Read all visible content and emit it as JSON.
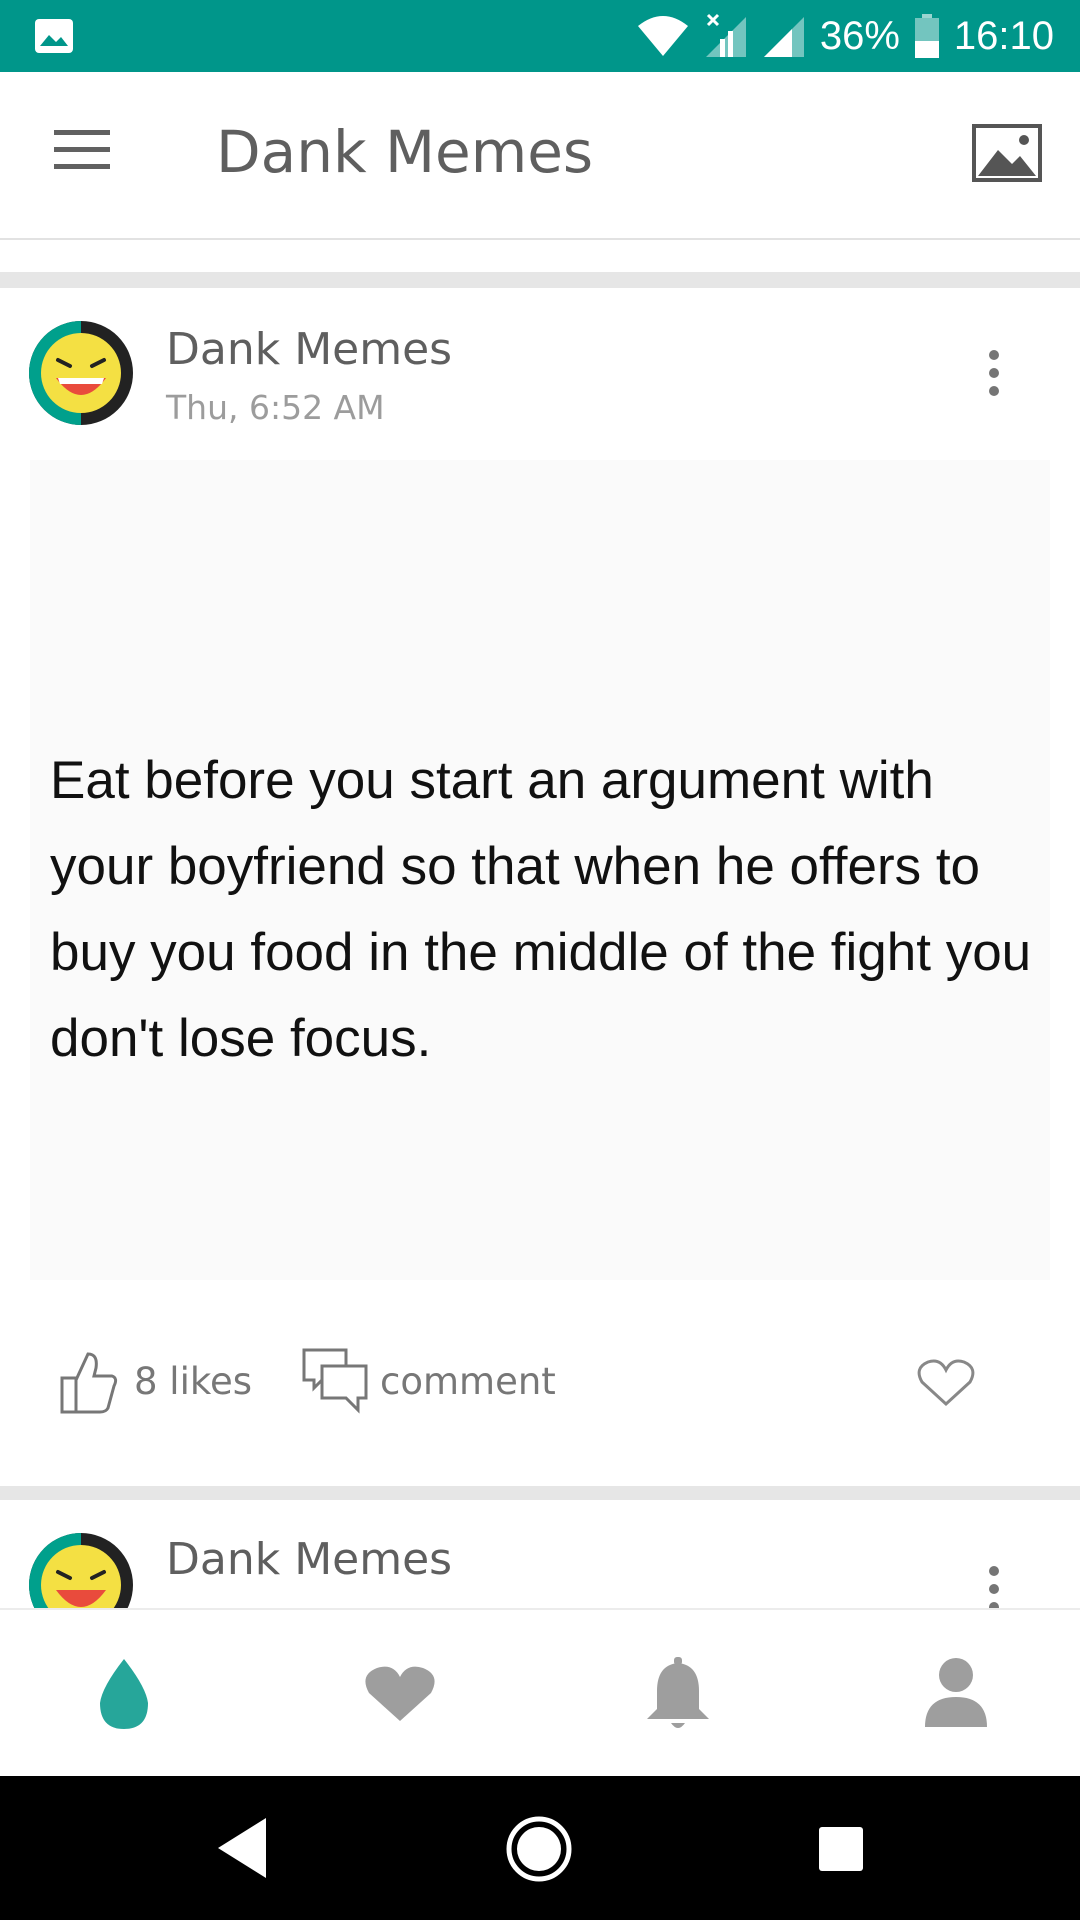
{
  "status_bar": {
    "battery": "36%",
    "time": "16:10",
    "icons": [
      "image-notification-icon",
      "wifi-icon",
      "signal-x-icon",
      "signal-icon",
      "battery-icon"
    ],
    "color": "#00968a"
  },
  "app_bar": {
    "title": "Dank Memes",
    "icons": [
      "menu-icon",
      "gallery-icon"
    ]
  },
  "posts": [
    {
      "author": "Dank Memes",
      "time": "Thu, 6:52 AM",
      "meme_text": "Eat before you start an argument with your boyfriend so that when he offers to buy you food in the middle of the fight you don't lose focus.",
      "likes": "8 likes",
      "comment": "comment"
    },
    {
      "author": "Dank Memes"
    }
  ],
  "bottom_nav": {
    "items": [
      "home-drop-icon",
      "heart-icon",
      "bell-icon",
      "profile-icon"
    ],
    "active_color": "#26a69a",
    "inactive_color": "#9e9e9e"
  },
  "system_nav": {
    "items": [
      "back-icon",
      "home-icon",
      "recents-icon"
    ]
  }
}
